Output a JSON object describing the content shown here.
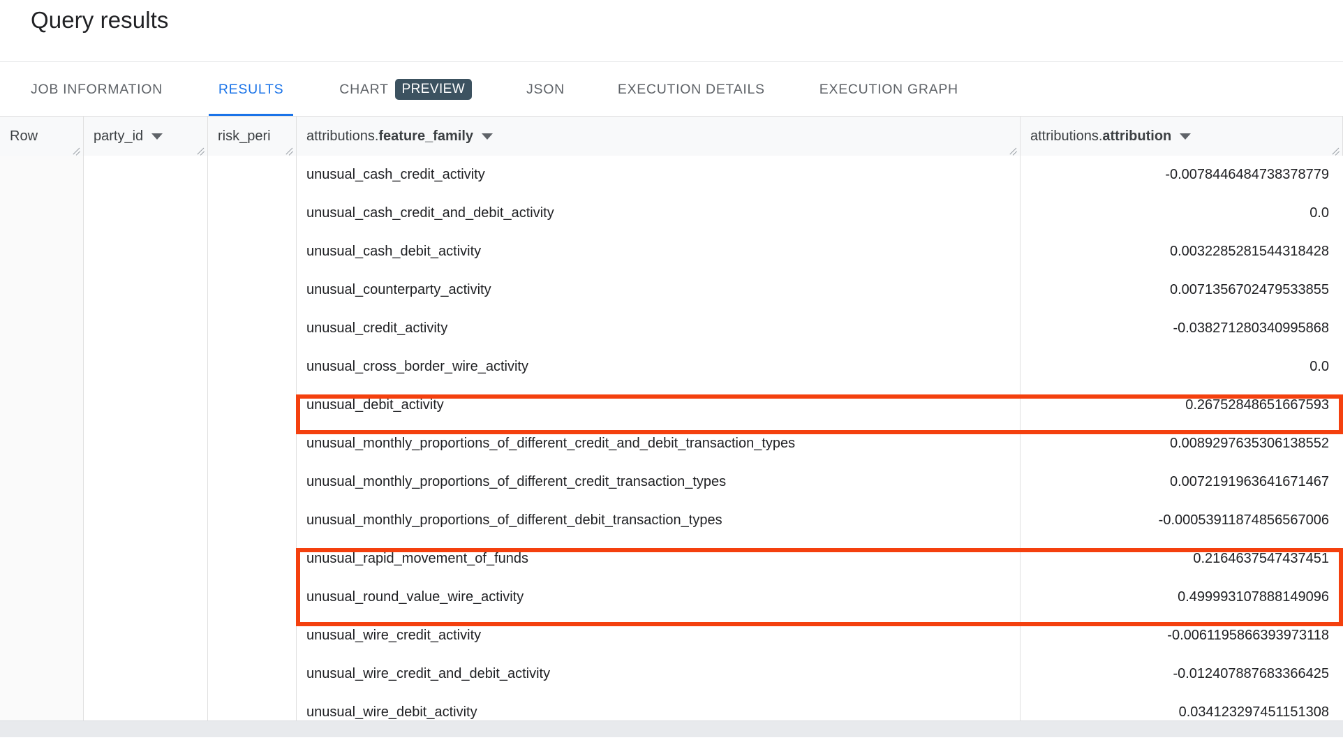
{
  "page": {
    "title": "Query results"
  },
  "tabs": [
    {
      "id": "job-information",
      "label": "JOB INFORMATION",
      "active": false
    },
    {
      "id": "results",
      "label": "RESULTS",
      "active": true
    },
    {
      "id": "chart",
      "label": "CHART",
      "active": false,
      "badge": "PREVIEW"
    },
    {
      "id": "json",
      "label": "JSON",
      "active": false
    },
    {
      "id": "execution-details",
      "label": "EXECUTION DETAILS",
      "active": false
    },
    {
      "id": "execution-graph",
      "label": "EXECUTION GRAPH",
      "active": false
    }
  ],
  "table": {
    "columns": [
      {
        "id": "row",
        "label": "Row",
        "prefix": "",
        "bold": "",
        "has_caret": false,
        "has_grip": true,
        "align": "left"
      },
      {
        "id": "party_id",
        "label": "party_id",
        "prefix": "",
        "bold": "",
        "has_caret": true,
        "has_grip": true,
        "align": "left"
      },
      {
        "id": "risk_period",
        "label": "risk_peri",
        "prefix": "",
        "bold": "",
        "has_caret": false,
        "has_grip": true,
        "align": "left"
      },
      {
        "id": "feature_family",
        "label": "attributions.feature_family",
        "prefix": "attributions.",
        "bold": "feature_family",
        "has_caret": true,
        "has_grip": true,
        "align": "left"
      },
      {
        "id": "attribution",
        "label": "attributions.attribution",
        "prefix": "attributions.",
        "bold": "attribution",
        "has_caret": true,
        "has_grip": true,
        "align": "left"
      }
    ],
    "rows": [
      {
        "feature_family": "unusual_cash_credit_activity",
        "attribution": "-0.0078446484738378779"
      },
      {
        "feature_family": "unusual_cash_credit_and_debit_activity",
        "attribution": "0.0"
      },
      {
        "feature_family": "unusual_cash_debit_activity",
        "attribution": "0.0032285281544318428"
      },
      {
        "feature_family": "unusual_counterparty_activity",
        "attribution": "0.0071356702479533855"
      },
      {
        "feature_family": "unusual_credit_activity",
        "attribution": "-0.038271280340995868"
      },
      {
        "feature_family": "unusual_cross_border_wire_activity",
        "attribution": "0.0"
      },
      {
        "feature_family": "unusual_debit_activity",
        "attribution": "0.26752848651667593"
      },
      {
        "feature_family": "unusual_monthly_proportions_of_different_credit_and_debit_transaction_types",
        "attribution": "0.0089297635306138552"
      },
      {
        "feature_family": "unusual_monthly_proportions_of_different_credit_transaction_types",
        "attribution": "0.0072191963641671467"
      },
      {
        "feature_family": "unusual_monthly_proportions_of_different_debit_transaction_types",
        "attribution": "-0.00053911874856567006"
      },
      {
        "feature_family": "unusual_rapid_movement_of_funds",
        "attribution": "0.2164637547437451"
      },
      {
        "feature_family": "unusual_round_value_wire_activity",
        "attribution": "0.499993107888149096"
      },
      {
        "feature_family": "unusual_wire_credit_activity",
        "attribution": "-0.0061195866393973118"
      },
      {
        "feature_family": "unusual_wire_credit_and_debit_activity",
        "attribution": "-0.012407887683366425"
      },
      {
        "feature_family": "unusual_wire_debit_activity",
        "attribution": "0.034123297451151308"
      }
    ]
  },
  "annotations": {
    "highlight_color": "#f4400e",
    "boxes": [
      {
        "id": "highlight-box-1",
        "rows": [
          "unusual_debit_activity"
        ]
      },
      {
        "id": "highlight-box-2",
        "rows": [
          "unusual_rapid_movement_of_funds",
          "unusual_round_value_wire_activity"
        ]
      }
    ]
  },
  "colors": {
    "accent": "#1a73e8",
    "preview_chip": "#3c5260",
    "highlight": "#f4400e",
    "header_bg": "#f8f9fa"
  }
}
